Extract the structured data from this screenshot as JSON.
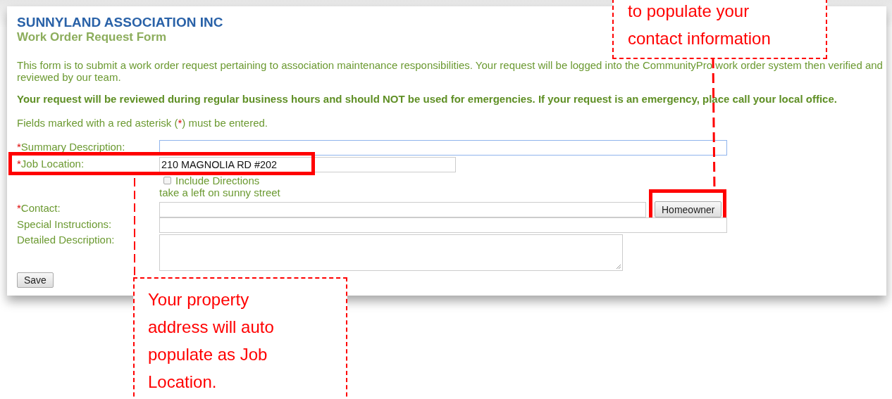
{
  "header": {
    "title": "SUNNYLAND ASSOCIATION INC",
    "subtitle": "Work Order Request Form"
  },
  "intro": "This form is to submit a work order request pertaining to association maintenance responsibilities. Your request will be logged into the CommunityPro work order system then verified and reviewed by our team.",
  "notice": "Your request will be reviewed during regular business hours and should NOT be used for emergencies. If your request is an emergency, place call your local office.",
  "required_note": {
    "before": "Fields marked with a red asterisk (",
    "asterisk": "*",
    "after": ") must be entered."
  },
  "fields": [
    {
      "kind": "text",
      "label": "Summary Description:",
      "required": true,
      "focused": true
    },
    {
      "kind": "text",
      "label": "Job Location:",
      "required": true,
      "focused": false,
      "value": "210 MAGNOLIA RD #202",
      "extra": {
        "checkbox": {
          "label": "Include Directions",
          "checked": false
        },
        "directions": "take a left on sunny street"
      }
    },
    {
      "kind": "button",
      "label": "Contact:",
      "required": true,
      "focused": false,
      "button": "Homeowner"
    },
    {
      "kind": "text",
      "label": "Special Instructions:",
      "required": false,
      "focused": false
    },
    {
      "kind": "textarea",
      "label": "Detailed Description:",
      "required": false,
      "focused": false
    }
  ],
  "save_button": "Save",
  "callouts": [
    {
      "text": "to populate your\ncontact information"
    },
    {
      "text": "Your property\naddress will auto\npopulate as Job\nLocation."
    }
  ]
}
